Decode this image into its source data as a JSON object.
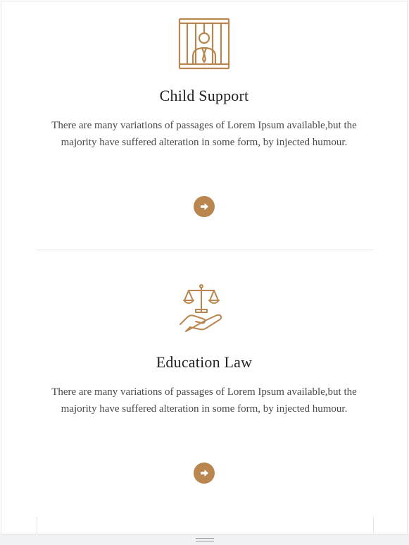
{
  "services": [
    {
      "icon": "prisoner-behind-bars-icon",
      "title": "Child Support",
      "description": "There are many variations of passages of Lorem Ipsum available,but the majority have suffered alteration in some form, by injected humour.",
      "action_icon": "arrow-right-circle-icon"
    },
    {
      "icon": "scales-in-hand-icon",
      "title": "Education Law",
      "description": "There are many variations of passages of Lorem Ipsum available,but the majority have suffered alteration in some form, by injected humour.",
      "action_icon": "arrow-right-circle-icon"
    }
  ],
  "colors": {
    "accent": "#b9864f",
    "title": "#222222",
    "text": "#4a4a4a",
    "divider": "#e4e4e4"
  },
  "bottom_bar": {
    "icon": "resize-grip-icon"
  }
}
